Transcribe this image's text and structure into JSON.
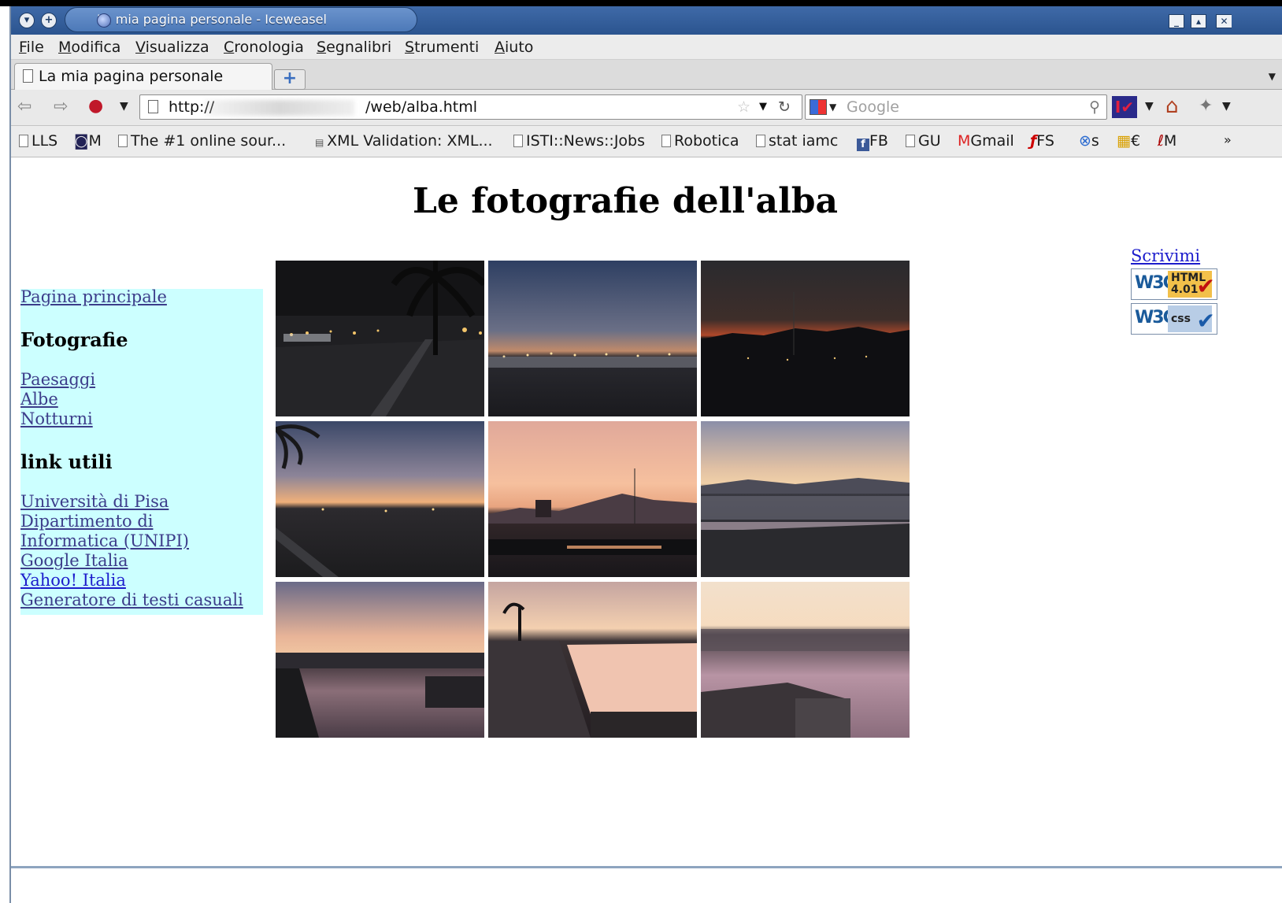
{
  "window": {
    "title": "La mia pagina personale - Iceweasel"
  },
  "menu": {
    "items": [
      "File",
      "Modifica",
      "Visualizza",
      "Cronologia",
      "Segnalibri",
      "Strumenti",
      "Aiuto"
    ]
  },
  "tabs": [
    {
      "label": "La mia pagina personale",
      "active": true
    }
  ],
  "navigation": {
    "url_prefix": "http://",
    "url_suffix": "/web/alba.html",
    "search_placeholder": "Google"
  },
  "bookmarks": [
    "LLS",
    "M",
    "The #1 online sour...",
    "XML Validation: XML...",
    "ISTI::News::Jobs",
    "Robotica",
    "stat iamc",
    "FB",
    "GU",
    "Gmail",
    "FS",
    "s",
    "€",
    "M"
  ],
  "page": {
    "heading": "Le fotografie dell'alba",
    "sidebar": {
      "home_link": "Pagina principale",
      "photos_heading": "Fotografie",
      "photo_links": [
        "Paesaggi",
        "Albe",
        "Notturni"
      ],
      "links_heading": "link utili",
      "useful_links": [
        "Università di Pisa",
        "Dipartimento di",
        "Informatica (UNIPI)",
        "Google Italia",
        "Yahoo! Italia",
        "Generatore di testi casuali"
      ]
    },
    "right": {
      "contact_link": "Scrivimi",
      "badge_html": {
        "logo": "W3C",
        "line1": "HTML",
        "line2": "4.01"
      },
      "badge_css": {
        "logo": "W3C",
        "label": "css"
      }
    }
  },
  "colors": {
    "sidebar_bg": "#ccffff",
    "link": "#3c3c8a",
    "titlebar": "#2b548f"
  }
}
